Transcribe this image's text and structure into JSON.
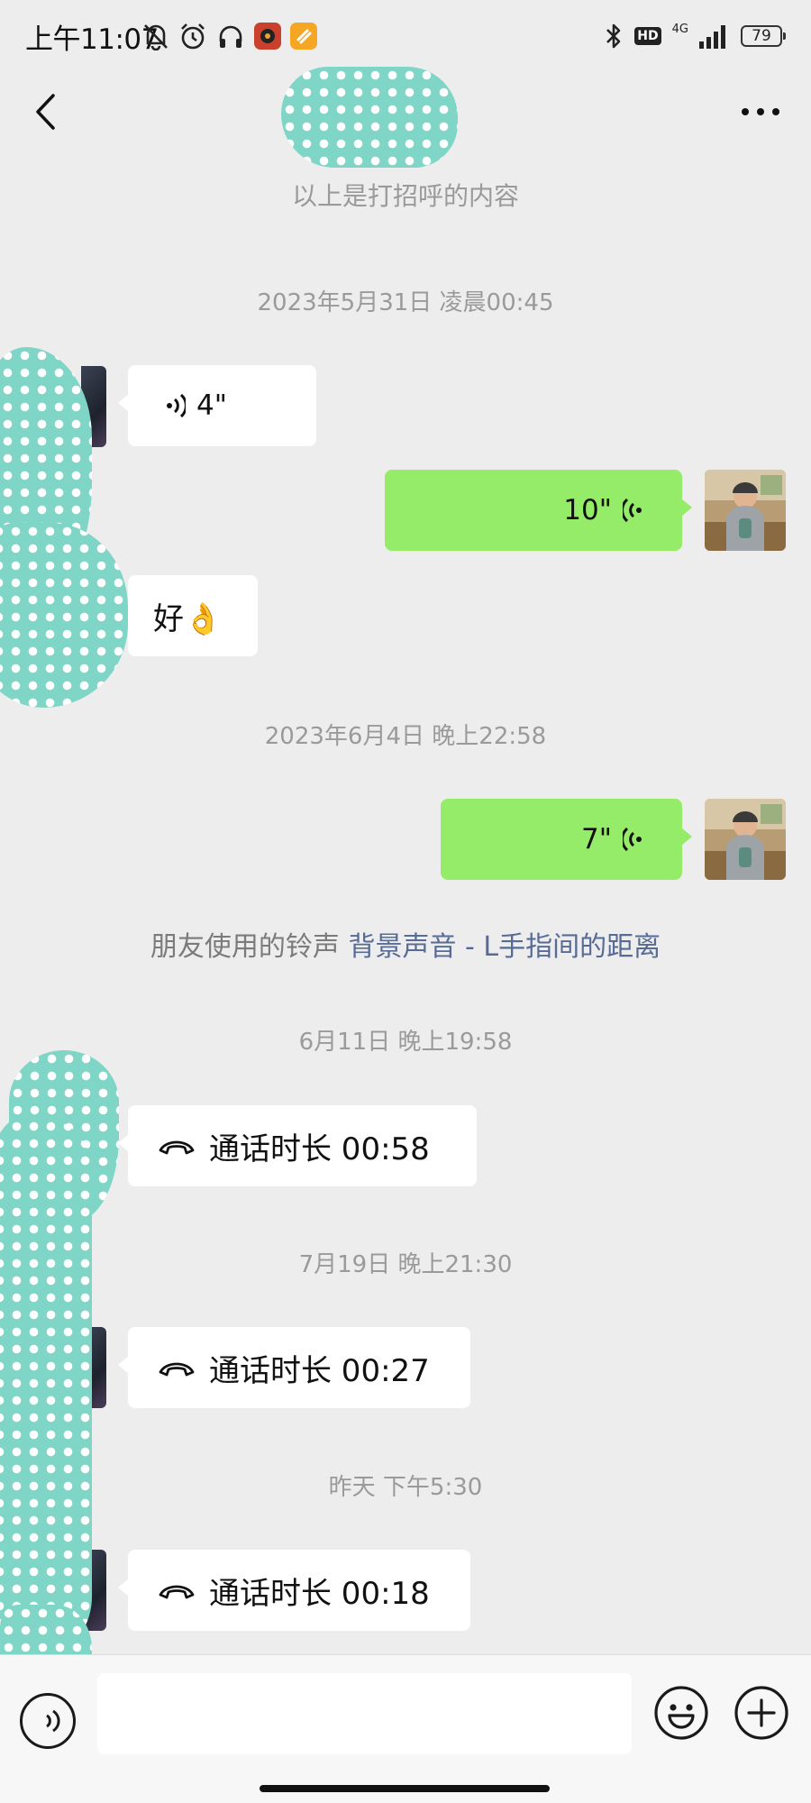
{
  "status_bar": {
    "time": "上午11:07",
    "network": "4G",
    "hd": "HD",
    "battery": "79",
    "icons_left": [
      "bell-off-icon",
      "alarm-icon",
      "headphones-icon",
      "music-app-icon",
      "orange-app-icon"
    ],
    "icons_right": [
      "bluetooth-icon",
      "hd-icon",
      "signal-icon",
      "battery-icon"
    ]
  },
  "header": {
    "contact_name_redacted": true,
    "back_icon": "chevron-left-icon",
    "more_icon": "ellipsis-icon"
  },
  "chat": {
    "greeting_note": "以上是打招呼的内容",
    "groups": [
      {
        "timestamp": "2023年5月31日 凌晨00:45",
        "messages": [
          {
            "side": "in",
            "type": "voice",
            "duration": "4\""
          },
          {
            "side": "out",
            "type": "voice",
            "duration": "10\""
          },
          {
            "side": "in",
            "type": "text",
            "text": "好👌"
          }
        ]
      },
      {
        "timestamp": "2023年6月4日 晚上22:58",
        "messages": [
          {
            "side": "out",
            "type": "voice",
            "duration": "7\""
          }
        ]
      },
      {
        "ringtone_prefix": "朋友使用的铃声",
        "ringtone_link": "背景声音 - L手指间的距离"
      },
      {
        "timestamp": "6月11日 晚上19:58",
        "messages": [
          {
            "side": "in",
            "type": "call",
            "text": "通话时长 00:58"
          }
        ]
      },
      {
        "timestamp": "7月19日 晚上21:30",
        "messages": [
          {
            "side": "in",
            "type": "call",
            "text": "通话时长 00:27"
          }
        ]
      },
      {
        "timestamp": "昨天 下午5:30",
        "messages": [
          {
            "side": "in",
            "type": "call",
            "text": "通话时长 00:18"
          }
        ]
      }
    ]
  },
  "input_bar": {
    "placeholder": "",
    "icons": [
      "voice-mode-icon",
      "emoji-icon",
      "plus-icon"
    ]
  },
  "colors": {
    "background": "#ededed",
    "outgoing_bubble": "#95ec69",
    "incoming_bubble": "#ffffff",
    "link": "#576b95",
    "meta_text": "#9a9a9a",
    "redaction": "#7fd6c6"
  }
}
